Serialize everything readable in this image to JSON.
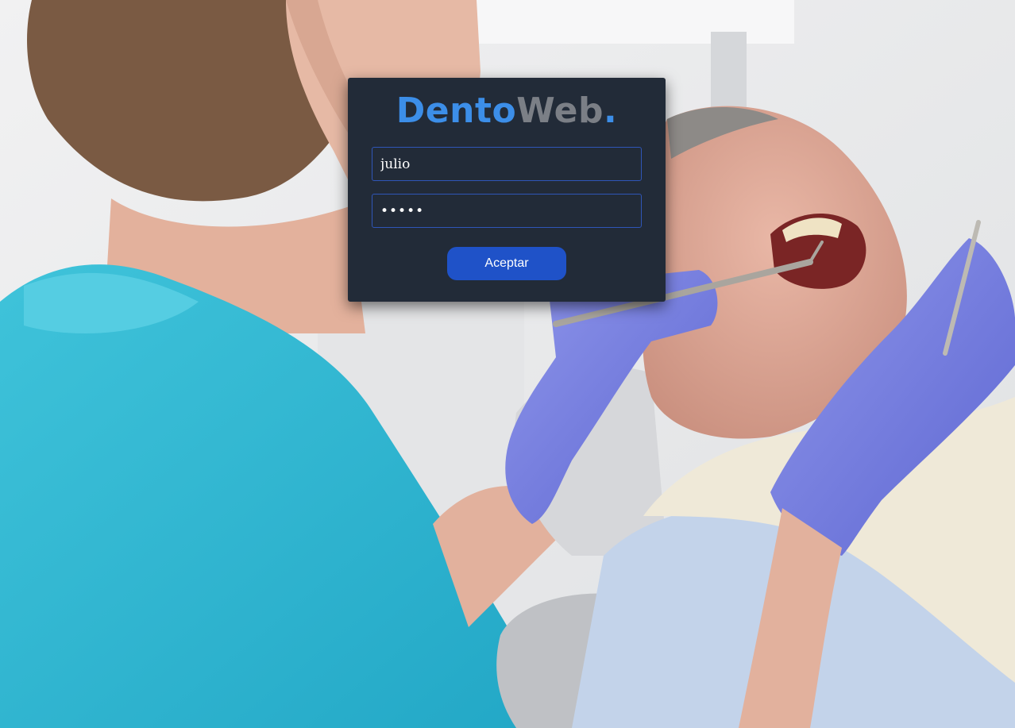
{
  "brand": {
    "part_a": "Dento",
    "part_b": "Web",
    "part_c": ".",
    "colors": {
      "primary": "#3c8ee8",
      "secondary": "#7b7f86"
    }
  },
  "login": {
    "username_value": "julio",
    "password_value": "12345",
    "submit_label": "Aceptar"
  },
  "theme": {
    "card_bg": "#222b38",
    "field_border": "#2f56b8",
    "button_bg": "#1f52c8"
  },
  "background": {
    "description_icon": "dental-photo-background"
  }
}
